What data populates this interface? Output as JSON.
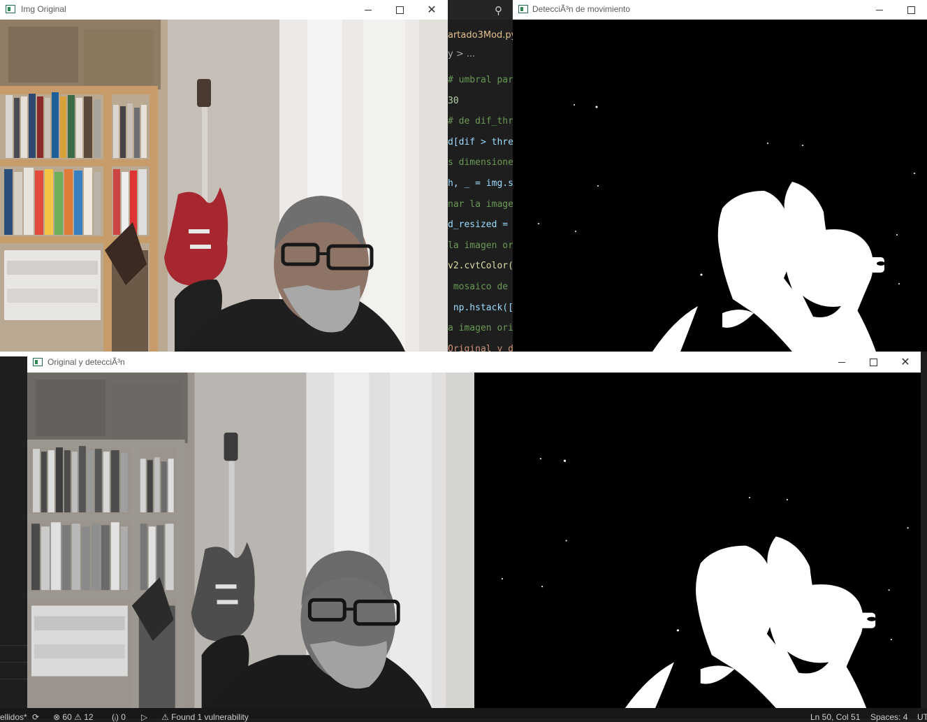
{
  "editor": {
    "tab_label": "artado3Mod.py",
    "breadcrumb": "y > ...",
    "code_lines": [
      {
        "text": "# umbral par",
        "cls": "cm"
      },
      {
        "text": "30",
        "cls": "nm"
      },
      {
        "text": "# de dif_thr",
        "cls": "cm"
      },
      {
        "text": "d[dif > thre",
        "cls": "vr"
      },
      {
        "text": "s dimensione",
        "cls": "cm"
      },
      {
        "text": "h, _ = img.s",
        "cls": "vr"
      },
      {
        "text": "nar la image",
        "cls": "cm"
      },
      {
        "text": "d_resized = ",
        "cls": "vr"
      },
      {
        "text": "la imagen or",
        "cls": "cm"
      },
      {
        "text": "v2.cvtColor(",
        "cls": "fn"
      },
      {
        "text": " mosaico de ",
        "cls": "cm"
      },
      {
        "text": " np.hstack([",
        "cls": "vr"
      },
      {
        "text": "a imagen ori",
        "cls": "cm"
      },
      {
        "text": "Original y d",
        "cls": "st"
      }
    ]
  },
  "windows": {
    "original": {
      "title": "Img Original"
    },
    "detection": {
      "title": "DetecciÃ³n de movimiento"
    },
    "combined": {
      "title": "Original y detecciÃ³n"
    }
  },
  "statusbar": {
    "branch": "ellidos*",
    "problems": "⊗ 60 ⚠ 12",
    "ports": "(ᵢ) 0",
    "vulnerability": "⚠ Found 1 vulnerability",
    "position": "Ln 50, Col 51",
    "spaces": "Spaces: 4",
    "encoding": "UT"
  },
  "colors": {
    "wall": "#c9c3bc",
    "curtain": "#ece9e6",
    "shelf": "#c79c6a",
    "guitar": "#a6272f",
    "shirt": "#1f1f1f",
    "mask_bg": "#000000",
    "mask_fg": "#ffffff"
  }
}
